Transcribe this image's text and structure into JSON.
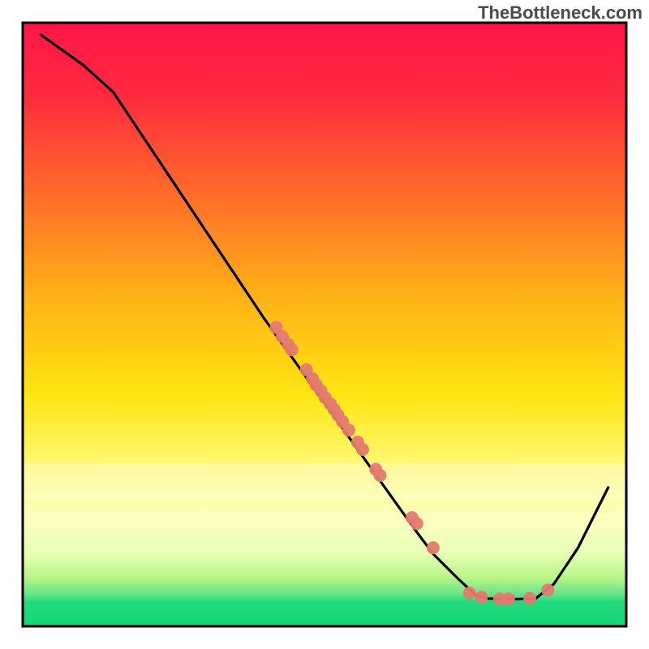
{
  "watermark": "TheBottleneck.com",
  "chart_data": {
    "type": "line",
    "title": "",
    "xlabel": "",
    "ylabel": "",
    "xlim": [
      0,
      100
    ],
    "ylim": [
      0,
      100
    ],
    "gradient": {
      "top": "#ff1846",
      "mid": "#ffe612",
      "green_band_top": "#a9f25f",
      "bottom": "#13d977"
    },
    "band": {
      "yellow_hilite_top_y": 73,
      "yellow_hilite_bottom_y": 79,
      "green_top_y": 94.5,
      "green_bottom_y": 97
    },
    "series": [
      {
        "name": "curve",
        "style": "black-line",
        "points_xy": [
          [
            3,
            2
          ],
          [
            10,
            7
          ],
          [
            15,
            11.5
          ],
          [
            20,
            19
          ],
          [
            25,
            26.5
          ],
          [
            30,
            34
          ],
          [
            35,
            41.5
          ],
          [
            40,
            49
          ],
          [
            45,
            56
          ],
          [
            50,
            63
          ],
          [
            55,
            70
          ],
          [
            60,
            77
          ],
          [
            65,
            84
          ],
          [
            68,
            88
          ],
          [
            72,
            92
          ],
          [
            75,
            94.8
          ],
          [
            77,
            95.4
          ],
          [
            80,
            95.5
          ],
          [
            82,
            95.5
          ],
          [
            85,
            95.4
          ],
          [
            88,
            93
          ],
          [
            92,
            87
          ],
          [
            95,
            81
          ],
          [
            97,
            77
          ]
        ]
      },
      {
        "name": "dots",
        "style": "salmon-dots",
        "points_xy": [
          [
            42,
            50.5
          ],
          [
            43,
            52
          ],
          [
            44,
            53.3
          ],
          [
            44.6,
            54.2
          ],
          [
            47,
            57.5
          ],
          [
            48,
            59
          ],
          [
            48.6,
            60
          ],
          [
            49.4,
            61
          ],
          [
            50.1,
            62.1
          ],
          [
            51,
            63.2
          ],
          [
            51.6,
            64.1
          ],
          [
            52.2,
            65
          ],
          [
            53,
            66.1
          ],
          [
            54,
            67.5
          ],
          [
            55.5,
            69.5
          ],
          [
            56.3,
            70.7
          ],
          [
            58.5,
            74
          ],
          [
            59.2,
            75
          ],
          [
            64.5,
            82
          ],
          [
            65.3,
            83
          ],
          [
            68,
            87
          ],
          [
            74,
            94.5
          ],
          [
            76,
            95.2
          ],
          [
            79,
            95.5
          ],
          [
            80.5,
            95.5
          ],
          [
            84,
            95.4
          ],
          [
            87,
            94
          ]
        ]
      }
    ],
    "colors": {
      "line": "#000000",
      "dot_fill": "#e47a6f",
      "plot_border": "#000000"
    }
  }
}
